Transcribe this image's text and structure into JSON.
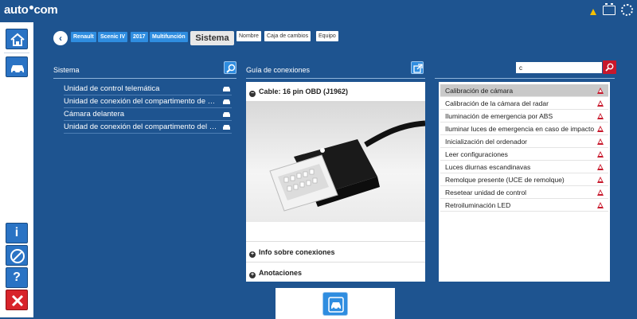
{
  "app": {
    "logo_text": "auto",
    "logo_text2": "com"
  },
  "status_icons": [
    "warning-icon",
    "battery-icon",
    "settings-gear-icon"
  ],
  "breadcrumb": {
    "items": [
      "Renault",
      "Scenic IV",
      "2017",
      "Multifunción"
    ],
    "active_tab": "Sistema",
    "other_tabs": [
      "Nombre",
      "Caja de cambios",
      "Equipo"
    ]
  },
  "systems": {
    "title": "Sistema",
    "items": [
      "Unidad de control telemática",
      "Unidad de conexión del compartimento de motor",
      "Cámara delantera",
      "Unidad de conexión del compartimento del automóvil"
    ]
  },
  "guide": {
    "title": "Guía de conexiones",
    "cable_label": "Cable: 16 pin OBD (J1962)",
    "sections": [
      "Info sobre conexiones",
      "Anotaciones"
    ]
  },
  "search": {
    "value": "c"
  },
  "functions": {
    "items": [
      "Calibración de cámara",
      "Calibración de la cámara del radar",
      "Iluminación de emergencia por ABS",
      "Iluminar luces de emergencia en caso de impacto",
      "Inicialización del ordenador",
      "Leer configuraciones",
      "Luces diurnas escandinavas",
      "Remolque presente (UCE de remolque)",
      "Resetear unidad de control",
      "Retroiluminación LED"
    ],
    "selected_index": 0
  },
  "colors": {
    "background": "#1e5490",
    "accent": "#2f8de0",
    "warning": "#c8182c"
  }
}
